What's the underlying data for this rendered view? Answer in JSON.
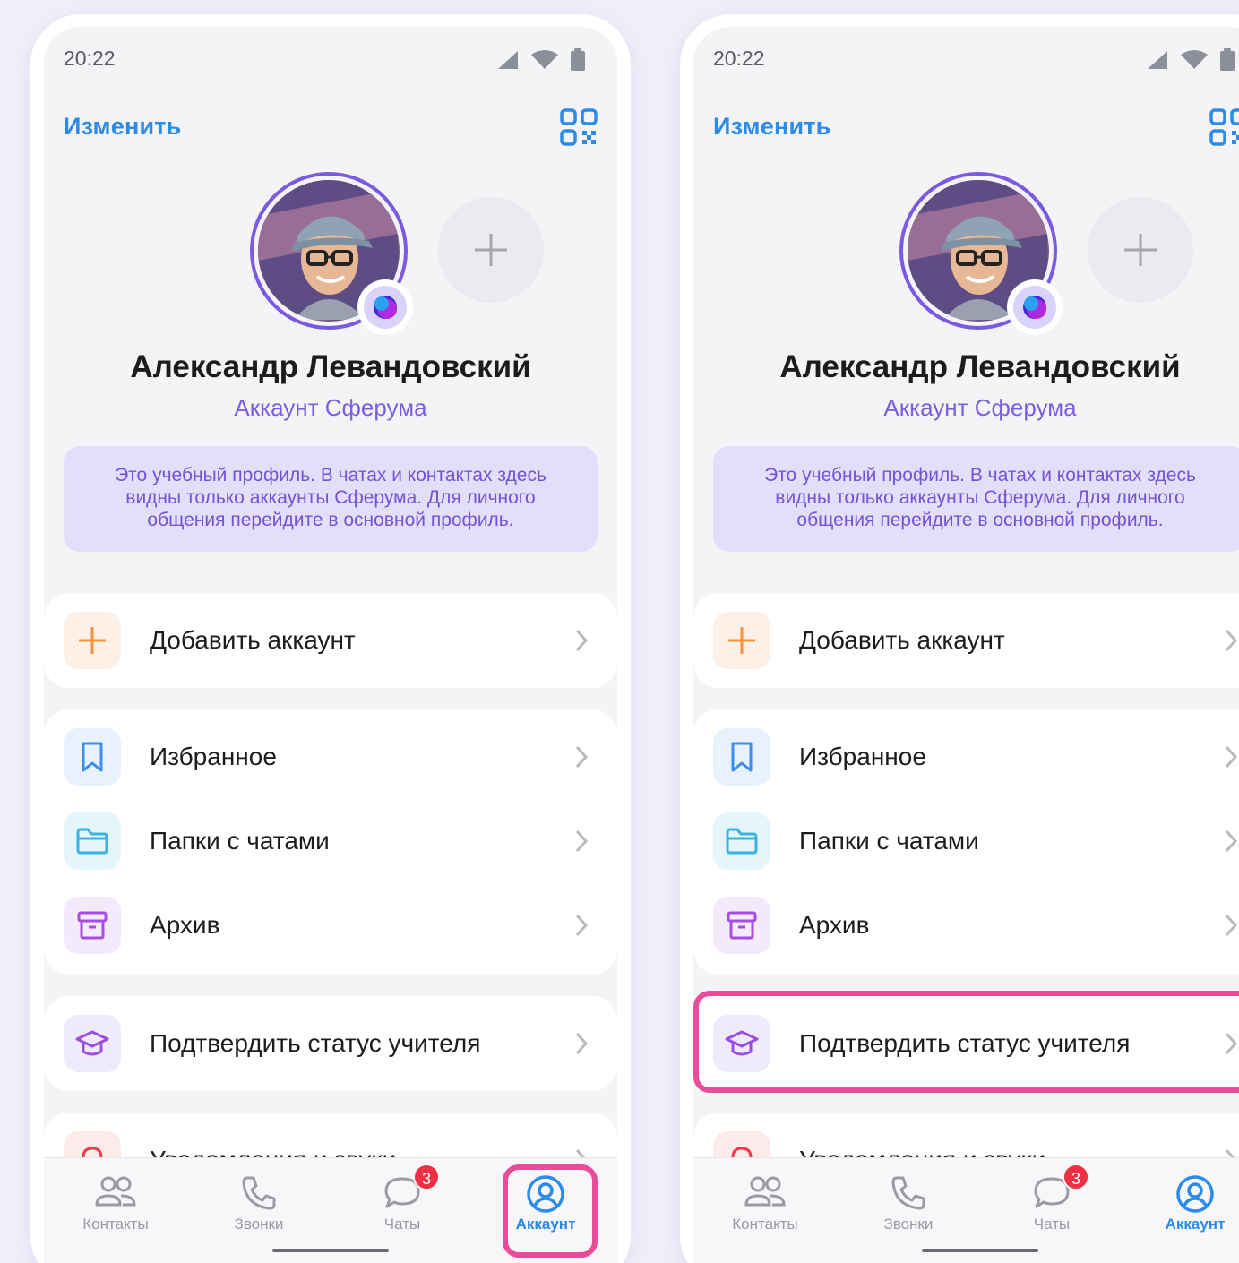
{
  "status_bar": {
    "time": "20:22"
  },
  "header": {
    "edit_label": "Изменить"
  },
  "profile": {
    "name": "Александр Левандовский",
    "account_type": "Аккаунт Сферума",
    "notice": "Это учебный профиль. В чатах и контактах здесь видны только аккаунты Сферума. Для личного общения перейдите в основной профиль."
  },
  "menu": {
    "add_account": "Добавить аккаунт",
    "favorites": "Избранное",
    "chat_folders": "Папки с чатами",
    "archive": "Архив",
    "confirm_teacher": "Подтвердить статус учителя",
    "notifications": "Уведомления и звуки"
  },
  "nav": {
    "contacts": "Контакты",
    "calls": "Звонки",
    "chats": "Чаты",
    "chats_badge": "3",
    "account": "Аккаунт"
  },
  "colors": {
    "accent_blue": "#2b8be6",
    "purple": "#7c5fe0",
    "highlight_pink": "#ea4c9a",
    "badge_red": "#ef2f44"
  }
}
